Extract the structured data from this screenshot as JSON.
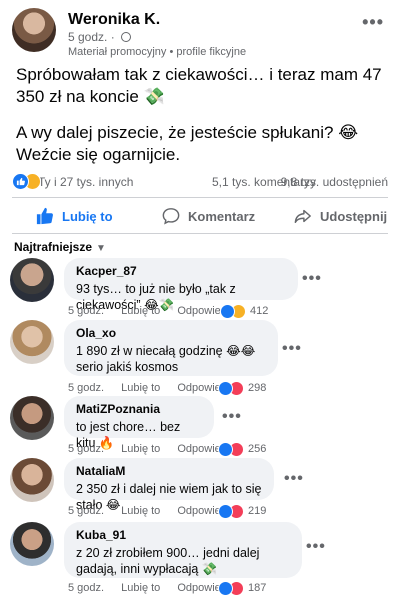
{
  "post": {
    "author": "Weronika K.",
    "time": "5 godz.",
    "separator": "·",
    "label": "Materiał promocyjny • profile fikcyjne",
    "text_line1": "Spróbowałam tak z ciekawości… i teraz mam 47 350 zł na koncie 💸",
    "text_line2": "A wy dalej piszecie, że jesteście spłukani? 😂",
    "text_line3": "Weźcie się ogarnijcie."
  },
  "stats": {
    "reactions": "Ty i 27 tys. innych",
    "comments": "5,1 tys. komentarzy",
    "shares": "9,8 tys. udostępnień"
  },
  "actions": {
    "like": "Lubię to",
    "comment": "Komentarz",
    "share": "Udostępnij"
  },
  "sort": {
    "label": "Najtrafniejsze"
  },
  "comments": [
    {
      "author": "Kacper_87",
      "text": "93 tys… to już nie było „tak z ciekawości” 😂💸",
      "time": "5 godz.",
      "like": "Lubię to",
      "reply": "Odpowiedz",
      "count": "412",
      "reactions": [
        "like",
        "haha"
      ]
    },
    {
      "author": "Ola_xo",
      "text": "1 890 zł w niecałą godzinę 😂😂 serio jakiś kosmos",
      "time": "5 godz.",
      "like": "Lubię to",
      "reply": "Odpowiedz",
      "count": "298",
      "reactions": [
        "like",
        "heart"
      ]
    },
    {
      "author": "MatiZPoznania",
      "text": "to jest chore… bez kitu 🔥",
      "time": "5 godz.",
      "like": "Lubię to",
      "reply": "Odpowiedz",
      "count": "256",
      "reactions": [
        "like",
        "heart"
      ]
    },
    {
      "author": "NataliaM",
      "text": "2 350 zł i dalej nie wiem jak to się stało 😂",
      "time": "5 godz.",
      "like": "Lubię to",
      "reply": "Odpowiedz",
      "count": "219",
      "reactions": [
        "like",
        "heart"
      ]
    },
    {
      "author": "Kuba_91",
      "text": "z 20 zł zrobiłem 900… jedni dalej gadają, inni wypłacają 💸",
      "time": "5 godz.",
      "like": "Lubię to",
      "reply": "Odpowiedz",
      "count": "187",
      "reactions": [
        "like",
        "heart"
      ]
    }
  ],
  "colors": {
    "accent": "#1877f2",
    "heart": "#f33e58",
    "haha": "#f7b125",
    "bubble": "#f0f2f5",
    "muted": "#65676b"
  }
}
